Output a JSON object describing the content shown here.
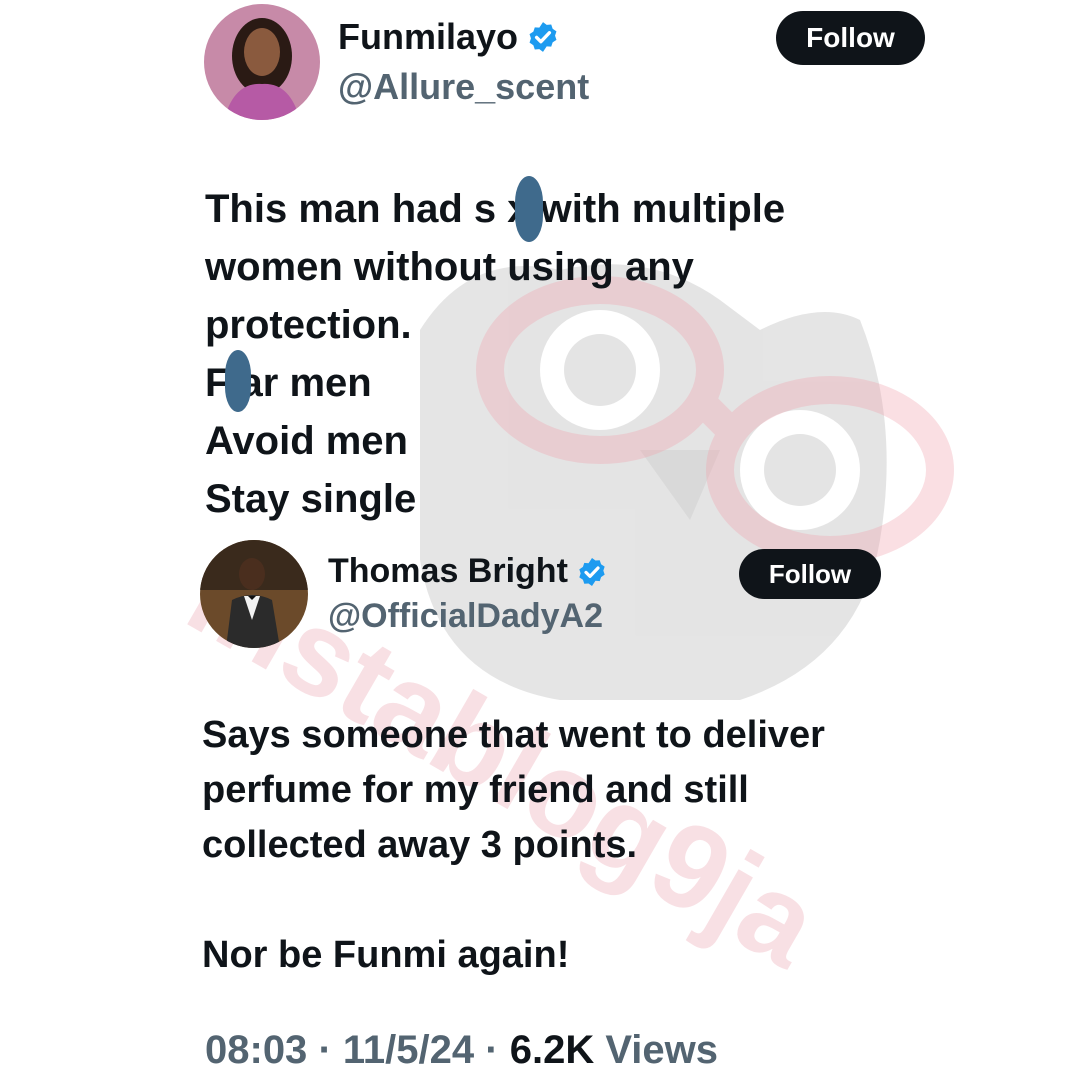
{
  "watermark": {
    "text": "instablog9ja",
    "color": "#f4c7cf"
  },
  "tweet_1": {
    "display_name": "Funmilayo",
    "handle": "@Allure_scent",
    "verified": true,
    "follow_label": "Follow",
    "text": "This man had s  x with multiple\nwomen without using any\nprotection.\nF  ar men\nAvoid men\nStay single"
  },
  "tweet_2": {
    "display_name": "Thomas Bright",
    "handle": "@OfficialDadyA2",
    "verified": true,
    "follow_label": "Follow",
    "text": "Says someone that went to deliver\nperfume for my friend and still\ncollected away 3 points.\n\nNor be Funmi again!"
  },
  "footer": {
    "time": "08:03",
    "date": "11/5/24",
    "views_count": "6.2K",
    "views_label": "Views",
    "separator": "·"
  },
  "colors": {
    "verified_badge": "#1d9bf0",
    "follow_button_bg": "#0f1419",
    "handle_gray": "#536471",
    "censor_mark": "#3f6a8c"
  }
}
